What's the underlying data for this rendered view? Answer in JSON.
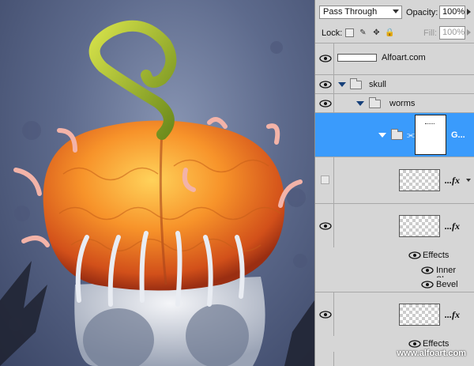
{
  "panel": {
    "blend_mode": "Pass Through",
    "opacity_label": "Opacity:",
    "opacity_value": "100%",
    "lock_label": "Lock:",
    "fill_label": "Fill:",
    "fill_value": "100%"
  },
  "layers": {
    "alfoart": "Alfoart.com",
    "skull": "skull",
    "worms": "worms",
    "group_g": "G...",
    "fx_mark": "...fx",
    "effects": "Effects",
    "inner_shadow": "Inner Sh...",
    "bevel": "Bevel an...",
    "effects2": "Effects"
  },
  "watermark": "www.alfoart.com",
  "colors": {
    "selection": "#3a9bfc",
    "panel": "#d6d6d6",
    "pumpkin": "#f07d1e",
    "stem": "#9bb02e"
  }
}
